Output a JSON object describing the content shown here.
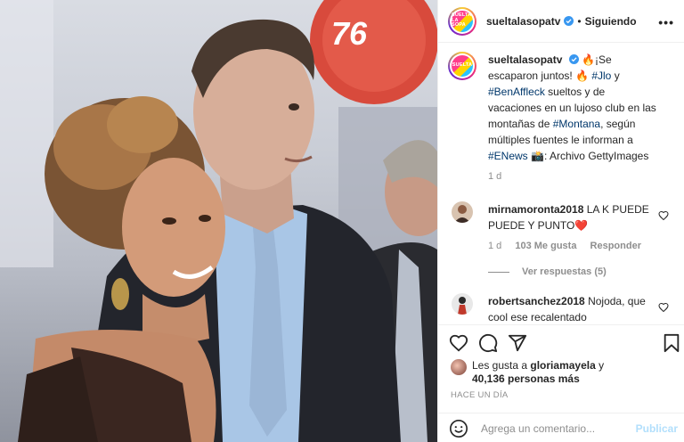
{
  "post": {
    "username": "sueltalasopatv",
    "follow_status": "Siguiendo",
    "avatar_text": "SUELTA LA SOPA",
    "more": "•••"
  },
  "caption": {
    "username": "sueltalasopatv",
    "text_1": " 🔥¡Se escaparon juntos! 🔥 ",
    "tag_jlo": "#Jlo",
    "text_2": " y ",
    "tag_ben": "#BenAffleck",
    "text_3": " sueltos y de vacaciones en un lujoso club en las montañas de ",
    "tag_montana": "#Montana",
    "text_4": ", según múltiples fuentes le informan a ",
    "tag_enews": "#ENews",
    "text_5": " 📸: Archivo GettyImages",
    "time": "1 d"
  },
  "comments": [
    {
      "username": "mirnamoronta2018",
      "text": " LA K PUEDE PUEDE Y PUNTO❤️",
      "time": "1 d",
      "likes": "103 Me gusta",
      "reply": "Responder",
      "view_replies": "Ver respuestas (5)"
    },
    {
      "username": "robertsanchez2018",
      "text": " Nojoda, que cool ese recalentado"
    }
  ],
  "actions": {
    "likes_prefix": "Les gusta a ",
    "likes_user": "gloriamayela",
    "likes_suffix": " y",
    "likes_count": "40,136 personas más",
    "time_ago": "HACE UN DÍA",
    "comment_placeholder": "Agrega un comentario...",
    "publish_label": "Publicar"
  },
  "colors": {
    "link": "#00376b",
    "verified": "#3897f0",
    "publish_disabled": "#b2dffc",
    "heart_red": "#ed4956"
  }
}
